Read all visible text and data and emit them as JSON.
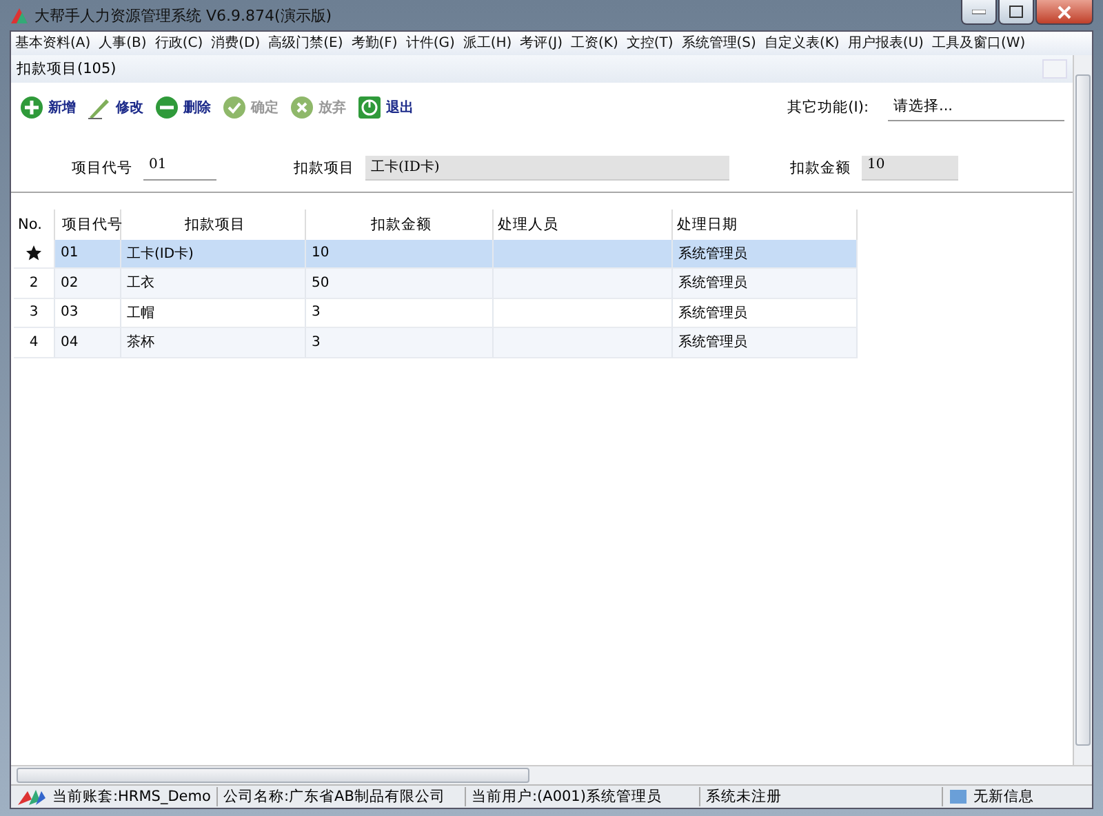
{
  "window": {
    "title": "大帮手人力资源管理系统 V6.9.874(演示版)"
  },
  "menu": [
    "基本资料(A)",
    "人事(B)",
    "行政(C)",
    "消费(D)",
    "高级门禁(E)",
    "考勤(F)",
    "计件(G)",
    "派工(H)",
    "考评(J)",
    "工资(K)",
    "文控(T)",
    "系统管理(S)",
    "自定义表(K)",
    "用户报表(U)",
    "工具及窗口(W)"
  ],
  "tab": {
    "label": "扣款项目(105)"
  },
  "toolbar": [
    {
      "kind": "add",
      "label": "新增",
      "disabled": false
    },
    {
      "kind": "edit",
      "label": "修改",
      "disabled": false
    },
    {
      "kind": "delete",
      "label": "删除",
      "disabled": false
    },
    {
      "kind": "confirm",
      "label": "确定",
      "disabled": true
    },
    {
      "kind": "cancel",
      "label": "放弃",
      "disabled": true
    },
    {
      "kind": "exit",
      "label": "退出",
      "disabled": false
    }
  ],
  "other_functions": {
    "label": "其它功能(I):",
    "value": "请选择..."
  },
  "form": [
    {
      "label": "项目代号",
      "value": "01",
      "kind": "underline"
    },
    {
      "label": "扣款项目",
      "value": "工卡(ID卡)",
      "kind": "readonly"
    },
    {
      "label": "扣款金额",
      "value": "10",
      "kind": "readonly"
    }
  ],
  "table": {
    "columns": [
      "No.",
      "项目代号",
      "扣款项目",
      "扣款金额",
      "处理人员",
      "处理日期"
    ],
    "rows": [
      {
        "selected": true,
        "code": "01",
        "item": "工卡(ID卡)",
        "amount": "10",
        "date_column": "系统管理员"
      },
      {
        "no": "2",
        "selected": false,
        "code": "02",
        "item": "工衣",
        "amount": "50",
        "date_column": "系统管理员"
      },
      {
        "no": "3",
        "selected": false,
        "code": "03",
        "item": "工帽",
        "amount": "3",
        "date_column": "系统管理员"
      },
      {
        "no": "4",
        "selected": false,
        "code": "04",
        "item": "茶杯",
        "amount": "3",
        "date_column": "系统管理员"
      }
    ]
  },
  "status_bar": [
    "当前账套:HRMS_Demo",
    "公司名称:广东省AB制品有限公司",
    "当前用户:(A001)系统管理员",
    "系统未注册",
    "无新信息"
  ]
}
